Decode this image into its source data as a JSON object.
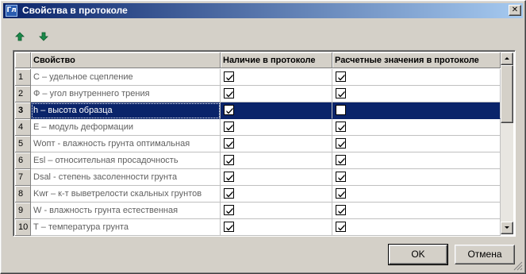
{
  "window": {
    "title": "Свойства в протоколе",
    "app_icon_text": "Гл",
    "close_glyph": "✕"
  },
  "toolbar": {
    "move_up_icon": "arrow-up-icon",
    "move_down_icon": "arrow-down-icon",
    "icon_color": "#1a8a4a"
  },
  "table": {
    "columns": [
      "Свойство",
      "Наличие в протоколе",
      "Расчетные значения в протоколе"
    ],
    "selected_row": 3,
    "selection_color": "#0a246a",
    "rows": [
      {
        "num": "1",
        "name": "С – удельное сцепление",
        "in_protocol": true,
        "calc_values": true
      },
      {
        "num": "2",
        "name": "Ф – угол внутреннего трения",
        "in_protocol": true,
        "calc_values": true
      },
      {
        "num": "3",
        "name": "h – высота образца",
        "in_protocol": true,
        "calc_values": false
      },
      {
        "num": "4",
        "name": "Е – модуль деформации",
        "in_protocol": true,
        "calc_values": true
      },
      {
        "num": "5",
        "name": "Wопт - влажность грунта оптимальная",
        "in_protocol": true,
        "calc_values": true
      },
      {
        "num": "6",
        "name": "Esl – относительная просадочность",
        "in_protocol": true,
        "calc_values": true
      },
      {
        "num": "7",
        "name": "Dsal - степень засоленности грунта",
        "in_protocol": true,
        "calc_values": true
      },
      {
        "num": "8",
        "name": "Kwr – к-т выветрелости скальных грунтов",
        "in_protocol": true,
        "calc_values": true
      },
      {
        "num": "9",
        "name": "W - влажность грунта естественная",
        "in_protocol": true,
        "calc_values": true
      },
      {
        "num": "10",
        "name": "Т – температура грунта",
        "in_protocol": true,
        "calc_values": true
      }
    ]
  },
  "buttons": {
    "ok": "OK",
    "cancel": "Отмена"
  }
}
